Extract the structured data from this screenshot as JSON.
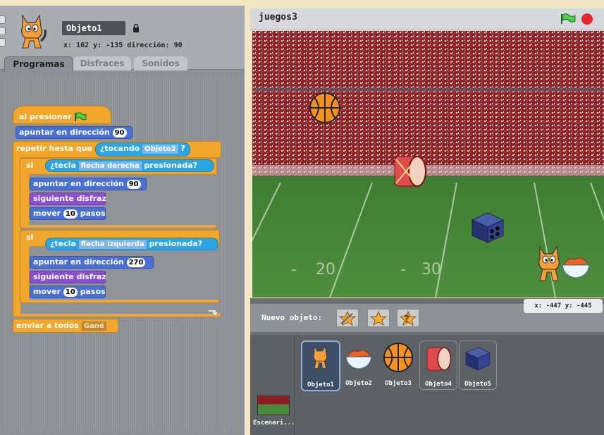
{
  "sprite": {
    "name": "Objeto1",
    "x_label": "x:",
    "x_value": "162",
    "y_label": "y:",
    "y_value": "-135",
    "dir_label": "dirección:",
    "dir_value": "90"
  },
  "tabs": [
    "Programas",
    "Disfraces",
    "Sonidos"
  ],
  "scripts": {
    "hat": "al presionar",
    "point1_text": "apuntar en dirección",
    "point1_val": "90",
    "repeat_text": "repetir hasta que",
    "touching_text": "¿tocando",
    "touching_val": "Objeto2",
    "touching_q": "?",
    "if1_label": "si",
    "key1_text": "¿tecla",
    "key1_val": "flecha derecha",
    "key1_end": "presionada?",
    "if1_point_text": "apuntar en dirección",
    "if1_point_val": "90",
    "if1_costume": "siguiente disfraz",
    "if1_move_text": "mover",
    "if1_move_val": "10",
    "if1_move_end": "pasos",
    "if2_label": "si",
    "key2_text": "¿tecla",
    "key2_val": "flecha izquierda",
    "key2_end": "presionada?",
    "if2_point_text": "apuntar en dirección",
    "if2_point_val": "270",
    "if2_costume": "siguiente disfraz",
    "if2_move_text": "mover",
    "if2_move_val": "10",
    "if2_move_end": "pasos",
    "broadcast_text": "enviar a todos",
    "broadcast_val": "Gané"
  },
  "stage": {
    "title": "juegos3",
    "field_numbers": [
      "20",
      "30"
    ],
    "mouse_x_label": "x:",
    "mouse_x": "-447",
    "mouse_y_label": "y:",
    "mouse_y": "-445",
    "new_sprite_label": "Nuevo objeto:"
  },
  "sprites": [
    {
      "name": "Objeto1",
      "selected": true
    },
    {
      "name": "Objeto2"
    },
    {
      "name": "Objeto3"
    },
    {
      "name": "Objeto4"
    },
    {
      "name": "Objeto5"
    }
  ],
  "stage_thumb_label": "Escenari...",
  "colors": {
    "control": "#f0a72b",
    "motion": "#4a6fd5",
    "looks": "#8b4fd1",
    "sensing": "#2ca5e2",
    "flag": "#2fae3d",
    "stop": "#e4272e"
  }
}
